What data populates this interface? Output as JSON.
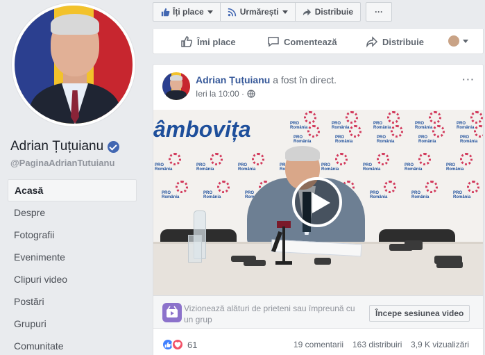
{
  "page": {
    "name": "Adrian Țuțuianu",
    "handle": "@PaginaAdrianTutuianu"
  },
  "nav": [
    {
      "label": "Acasă",
      "active": true
    },
    {
      "label": "Despre"
    },
    {
      "label": "Fotografii"
    },
    {
      "label": "Evenimente"
    },
    {
      "label": "Clipuri video"
    },
    {
      "label": "Postări"
    },
    {
      "label": "Grupuri"
    },
    {
      "label": "Comunitate"
    }
  ],
  "topbar": {
    "like": "Îți place",
    "follow": "Urmărești",
    "share": "Distribuie",
    "more": "···"
  },
  "prev_post_actions": {
    "like": "Îmi place",
    "comment": "Comentează",
    "share": "Distribuie"
  },
  "post": {
    "author": "Adrian Țuțuianu",
    "action_text": "a fost în direct.",
    "time": "Ieri la 10:00 ·",
    "video_banner": "âmbovița",
    "logo_text": "PRO\nRomânia",
    "watch_text": "Vizionează alături de prieteni sau împreună cu un grup",
    "watch_button": "Începe sesiunea video",
    "reaction_count": "61",
    "comments": "19 comentarii",
    "shares": "163 distribuiri",
    "views": "3,9 K vizualizări"
  },
  "colors": {
    "link": "#365899",
    "fb_blue": "#4267b2",
    "background": "#e9ebee"
  }
}
